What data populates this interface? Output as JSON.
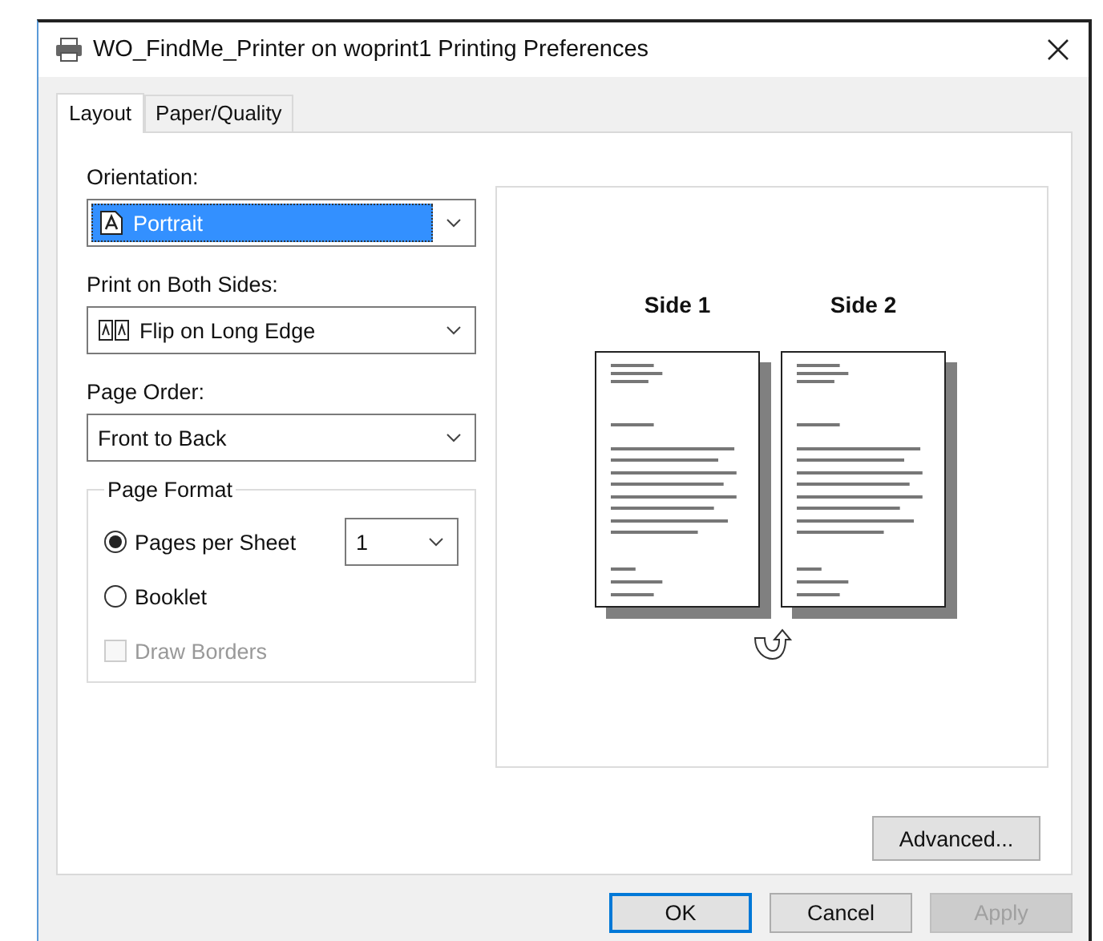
{
  "window": {
    "title": "WO_FindMe_Printer on woprint1 Printing Preferences"
  },
  "tabs": [
    {
      "label": "Layout",
      "selected": true
    },
    {
      "label": "Paper/Quality",
      "selected": false
    }
  ],
  "fields": [
    {
      "label": "Orientation:",
      "value": "Portrait",
      "kind": "portrait",
      "focused": true
    },
    {
      "label": "Print on Both Sides:",
      "value": "Flip on Long Edge",
      "kind": "duplex",
      "focused": false
    },
    {
      "label": "Page Order:",
      "value": "Front to Back",
      "kind": "plain",
      "focused": false
    }
  ],
  "page_format": {
    "title": "Page Format",
    "options": [
      {
        "label": "Pages per Sheet",
        "selected": true,
        "value": "1"
      },
      {
        "label": "Booklet",
        "selected": false
      }
    ],
    "draw_borders": {
      "label": "Draw Borders",
      "checked": false,
      "disabled": true
    }
  },
  "preview": {
    "sides": [
      {
        "label": "Side 1"
      },
      {
        "label": "Side 2"
      }
    ]
  },
  "advanced_button": {
    "label": "Advanced..."
  },
  "buttons": [
    {
      "label": "OK",
      "default": true,
      "disabled": false
    },
    {
      "label": "Cancel",
      "default": false,
      "disabled": false
    },
    {
      "label": "Apply",
      "default": false,
      "disabled": true
    }
  ]
}
